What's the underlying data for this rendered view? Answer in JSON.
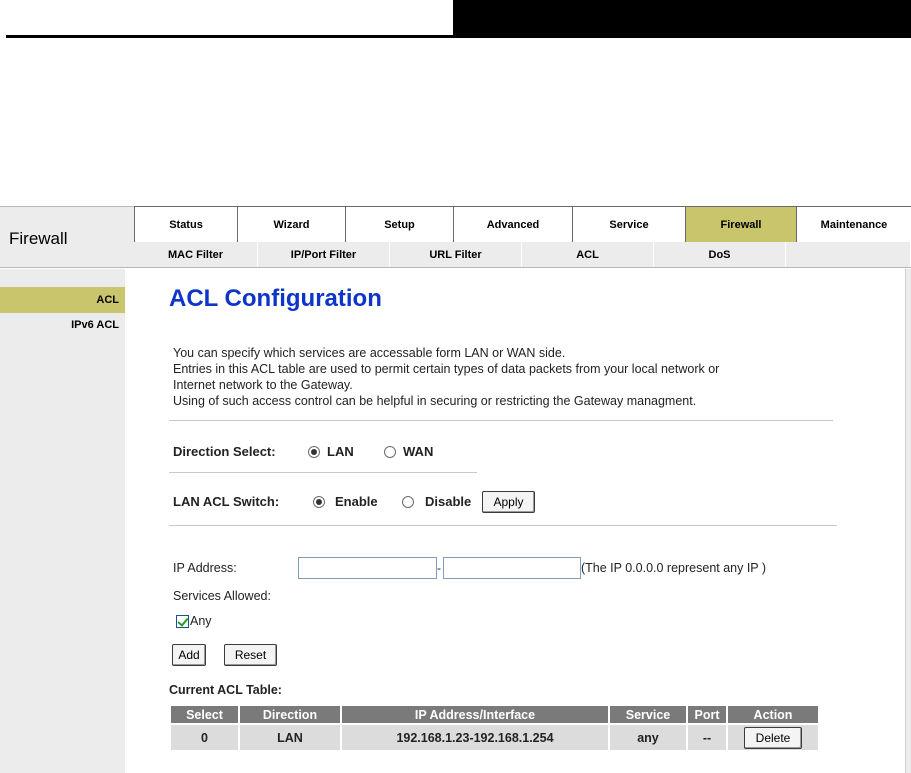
{
  "brand": {
    "title": "Firewall"
  },
  "main_tabs": [
    {
      "label": "Status",
      "active": false
    },
    {
      "label": "Wizard",
      "active": false
    },
    {
      "label": "Setup",
      "active": false
    },
    {
      "label": "Advanced",
      "active": false
    },
    {
      "label": "Service",
      "active": false
    },
    {
      "label": "Firewall",
      "active": true
    },
    {
      "label": "Maintenance",
      "active": false
    }
  ],
  "sub_tabs": [
    {
      "label": "MAC Filter"
    },
    {
      "label": "IP/Port Filter"
    },
    {
      "label": "URL Filter"
    },
    {
      "label": "ACL"
    },
    {
      "label": "DoS"
    },
    {
      "label": ""
    }
  ],
  "sidebar": {
    "items": [
      {
        "label": "ACL",
        "active": true
      },
      {
        "label": "IPv6 ACL",
        "active": false
      }
    ]
  },
  "page": {
    "title": "ACL Configuration",
    "intro_lines": [
      "You can specify which services are accessable form LAN or WAN side.",
      "Entries in this ACL table are used to permit certain types of data packets from your local network or",
      "Internet network to the Gateway.",
      "Using of such access control can be helpful in securing or restricting the Gateway managment."
    ]
  },
  "direction": {
    "label": "Direction Select:",
    "options": [
      "LAN",
      "WAN"
    ],
    "selected": "LAN"
  },
  "switch": {
    "label": "LAN ACL Switch:",
    "options": [
      "Enable",
      "Disable"
    ],
    "selected": "Enable",
    "apply_label": "Apply"
  },
  "form": {
    "ip_label": "IP Address:",
    "ip_start_value": "",
    "ip_end_value": "",
    "ip_separator": "-",
    "ip_hint": "(The IP 0.0.0.0 represent any IP )",
    "services_label": "Services Allowed:",
    "any_label": "Any",
    "any_checked": true,
    "add_label": "Add",
    "reset_label": "Reset"
  },
  "table": {
    "title": "Current ACL Table:",
    "columns": [
      "Select",
      "Direction",
      "IP Address/Interface",
      "Service",
      "Port",
      "Action"
    ],
    "rows": [
      {
        "select": "0",
        "direction": "LAN",
        "ip": "192.168.1.23-192.168.1.254",
        "service": "any",
        "port": "--",
        "action_label": "Delete"
      }
    ]
  },
  "colors": {
    "accent_tab": "#c9c56d",
    "title_blue": "#0f34c8",
    "panel_gray": "#ececec",
    "table_header": "#7a7a7a"
  }
}
